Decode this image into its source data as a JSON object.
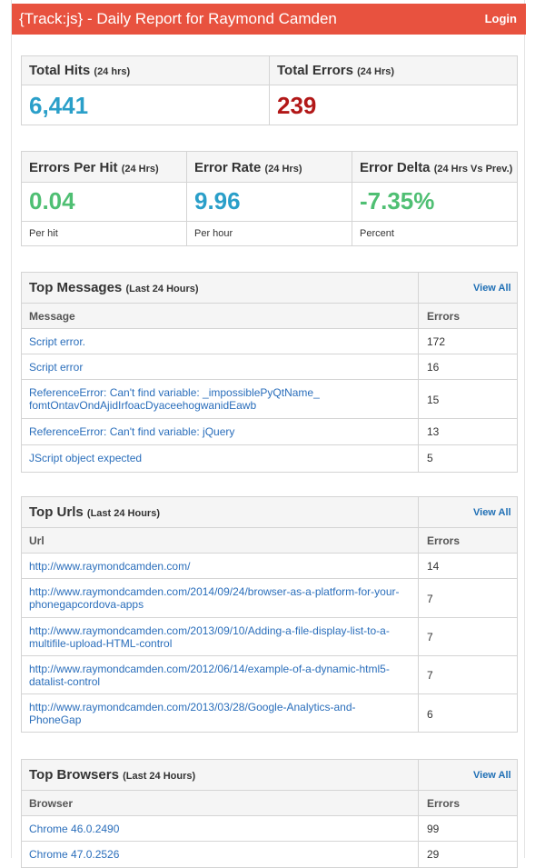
{
  "header": {
    "title": "{Track:js} - Daily Report for Raymond Camden",
    "login": "Login"
  },
  "summary": {
    "hits": {
      "label": "Total Hits",
      "sub": "(24 hrs)",
      "value": "6,441",
      "color": "#2a9fc9"
    },
    "errors": {
      "label": "Total Errors",
      "sub": "(24 Hrs)",
      "value": "239",
      "color": "#b21818"
    }
  },
  "metrics": [
    {
      "label": "Errors Per Hit",
      "sub": "(24 Hrs)",
      "value": "0.04",
      "foot": "Per hit",
      "color": "#4fbf73"
    },
    {
      "label": "Error Rate",
      "sub": "(24 Hrs)",
      "value": "9.96",
      "foot": "Per hour",
      "color": "#2a9fc9"
    },
    {
      "label": "Error Delta",
      "sub": "(24 Hrs Vs Prev.)",
      "value": "-7.35%",
      "foot": "Percent",
      "color": "#4fbf73"
    }
  ],
  "messages": {
    "title": "Top Messages",
    "sub": "(Last 24 Hours)",
    "view_all": "View All",
    "col1": "Message",
    "col2": "Errors",
    "rows": [
      {
        "l1": "Script error.",
        "l2": "",
        "n": "172"
      },
      {
        "l1": "Script error",
        "l2": "",
        "n": "16"
      },
      {
        "l1": "ReferenceError: Can't find variable: _impossiblePyQtName_",
        "l2": "fomtOntavOndAjidIrfoacDyaceehogwanidEawb",
        "n": "15"
      },
      {
        "l1": "ReferenceError: Can't find variable: jQuery",
        "l2": "",
        "n": "13"
      },
      {
        "l1": "JScript object expected",
        "l2": "",
        "n": "5"
      }
    ]
  },
  "urls": {
    "title": "Top Urls",
    "sub": "(Last 24 Hours)",
    "view_all": "View All",
    "col1": "Url",
    "col2": "Errors",
    "rows": [
      {
        "l1": "http://www.raymondcamden.com/",
        "l2": "",
        "n": "14"
      },
      {
        "l1": "http://www.raymondcamden.com/2014/09/24/browser-as-a-platform-for-your-",
        "l2": "phonegapcordova-apps",
        "n": "7"
      },
      {
        "l1": "http://www.raymondcamden.com/2013/09/10/Adding-a-file-display-list-to-a-",
        "l2": "multifile-upload-HTML-control",
        "n": "7"
      },
      {
        "l1": "http://www.raymondcamden.com/2012/06/14/example-of-a-dynamic-html5-",
        "l2": "datalist-control",
        "n": "7"
      },
      {
        "l1": "http://www.raymondcamden.com/2013/03/28/Google-Analytics-and-",
        "l2": "PhoneGap",
        "n": "6"
      }
    ]
  },
  "browsers": {
    "title": "Top Browsers",
    "sub": "(Last 24 Hours)",
    "view_all": "View All",
    "col1": "Browser",
    "col2": "Errors",
    "rows": [
      {
        "l1": "Chrome 46.0.2490",
        "l2": "",
        "n": "99"
      },
      {
        "l1": "Chrome 47.0.2526",
        "l2": "",
        "n": "29"
      }
    ]
  }
}
